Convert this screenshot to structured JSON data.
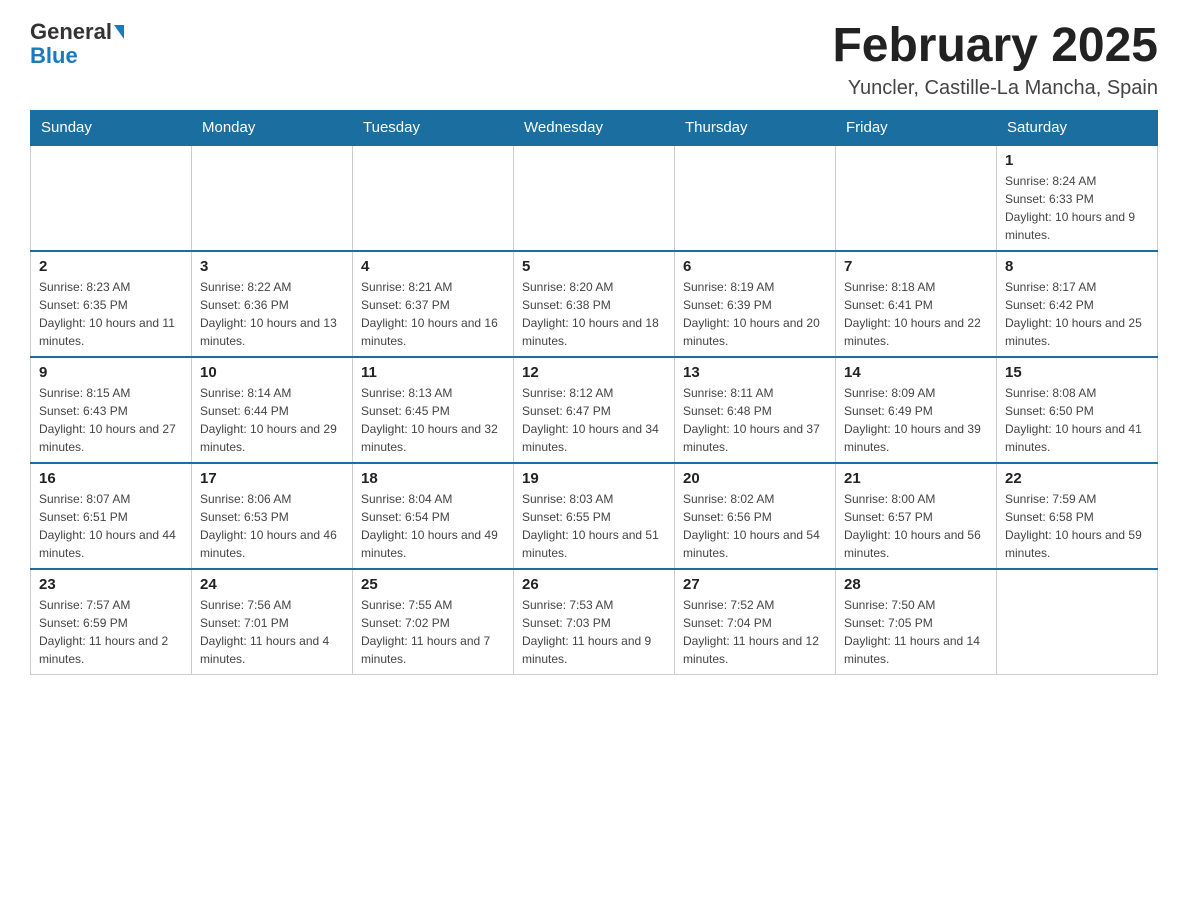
{
  "header": {
    "logo_general": "General",
    "logo_blue": "Blue",
    "month_title": "February 2025",
    "location": "Yuncler, Castille-La Mancha, Spain"
  },
  "weekdays": [
    "Sunday",
    "Monday",
    "Tuesday",
    "Wednesday",
    "Thursday",
    "Friday",
    "Saturday"
  ],
  "weeks": [
    [
      {
        "day": "",
        "info": ""
      },
      {
        "day": "",
        "info": ""
      },
      {
        "day": "",
        "info": ""
      },
      {
        "day": "",
        "info": ""
      },
      {
        "day": "",
        "info": ""
      },
      {
        "day": "",
        "info": ""
      },
      {
        "day": "1",
        "info": "Sunrise: 8:24 AM\nSunset: 6:33 PM\nDaylight: 10 hours and 9 minutes."
      }
    ],
    [
      {
        "day": "2",
        "info": "Sunrise: 8:23 AM\nSunset: 6:35 PM\nDaylight: 10 hours and 11 minutes."
      },
      {
        "day": "3",
        "info": "Sunrise: 8:22 AM\nSunset: 6:36 PM\nDaylight: 10 hours and 13 minutes."
      },
      {
        "day": "4",
        "info": "Sunrise: 8:21 AM\nSunset: 6:37 PM\nDaylight: 10 hours and 16 minutes."
      },
      {
        "day": "5",
        "info": "Sunrise: 8:20 AM\nSunset: 6:38 PM\nDaylight: 10 hours and 18 minutes."
      },
      {
        "day": "6",
        "info": "Sunrise: 8:19 AM\nSunset: 6:39 PM\nDaylight: 10 hours and 20 minutes."
      },
      {
        "day": "7",
        "info": "Sunrise: 8:18 AM\nSunset: 6:41 PM\nDaylight: 10 hours and 22 minutes."
      },
      {
        "day": "8",
        "info": "Sunrise: 8:17 AM\nSunset: 6:42 PM\nDaylight: 10 hours and 25 minutes."
      }
    ],
    [
      {
        "day": "9",
        "info": "Sunrise: 8:15 AM\nSunset: 6:43 PM\nDaylight: 10 hours and 27 minutes."
      },
      {
        "day": "10",
        "info": "Sunrise: 8:14 AM\nSunset: 6:44 PM\nDaylight: 10 hours and 29 minutes."
      },
      {
        "day": "11",
        "info": "Sunrise: 8:13 AM\nSunset: 6:45 PM\nDaylight: 10 hours and 32 minutes."
      },
      {
        "day": "12",
        "info": "Sunrise: 8:12 AM\nSunset: 6:47 PM\nDaylight: 10 hours and 34 minutes."
      },
      {
        "day": "13",
        "info": "Sunrise: 8:11 AM\nSunset: 6:48 PM\nDaylight: 10 hours and 37 minutes."
      },
      {
        "day": "14",
        "info": "Sunrise: 8:09 AM\nSunset: 6:49 PM\nDaylight: 10 hours and 39 minutes."
      },
      {
        "day": "15",
        "info": "Sunrise: 8:08 AM\nSunset: 6:50 PM\nDaylight: 10 hours and 41 minutes."
      }
    ],
    [
      {
        "day": "16",
        "info": "Sunrise: 8:07 AM\nSunset: 6:51 PM\nDaylight: 10 hours and 44 minutes."
      },
      {
        "day": "17",
        "info": "Sunrise: 8:06 AM\nSunset: 6:53 PM\nDaylight: 10 hours and 46 minutes."
      },
      {
        "day": "18",
        "info": "Sunrise: 8:04 AM\nSunset: 6:54 PM\nDaylight: 10 hours and 49 minutes."
      },
      {
        "day": "19",
        "info": "Sunrise: 8:03 AM\nSunset: 6:55 PM\nDaylight: 10 hours and 51 minutes."
      },
      {
        "day": "20",
        "info": "Sunrise: 8:02 AM\nSunset: 6:56 PM\nDaylight: 10 hours and 54 minutes."
      },
      {
        "day": "21",
        "info": "Sunrise: 8:00 AM\nSunset: 6:57 PM\nDaylight: 10 hours and 56 minutes."
      },
      {
        "day": "22",
        "info": "Sunrise: 7:59 AM\nSunset: 6:58 PM\nDaylight: 10 hours and 59 minutes."
      }
    ],
    [
      {
        "day": "23",
        "info": "Sunrise: 7:57 AM\nSunset: 6:59 PM\nDaylight: 11 hours and 2 minutes."
      },
      {
        "day": "24",
        "info": "Sunrise: 7:56 AM\nSunset: 7:01 PM\nDaylight: 11 hours and 4 minutes."
      },
      {
        "day": "25",
        "info": "Sunrise: 7:55 AM\nSunset: 7:02 PM\nDaylight: 11 hours and 7 minutes."
      },
      {
        "day": "26",
        "info": "Sunrise: 7:53 AM\nSunset: 7:03 PM\nDaylight: 11 hours and 9 minutes."
      },
      {
        "day": "27",
        "info": "Sunrise: 7:52 AM\nSunset: 7:04 PM\nDaylight: 11 hours and 12 minutes."
      },
      {
        "day": "28",
        "info": "Sunrise: 7:50 AM\nSunset: 7:05 PM\nDaylight: 11 hours and 14 minutes."
      },
      {
        "day": "",
        "info": ""
      }
    ]
  ]
}
